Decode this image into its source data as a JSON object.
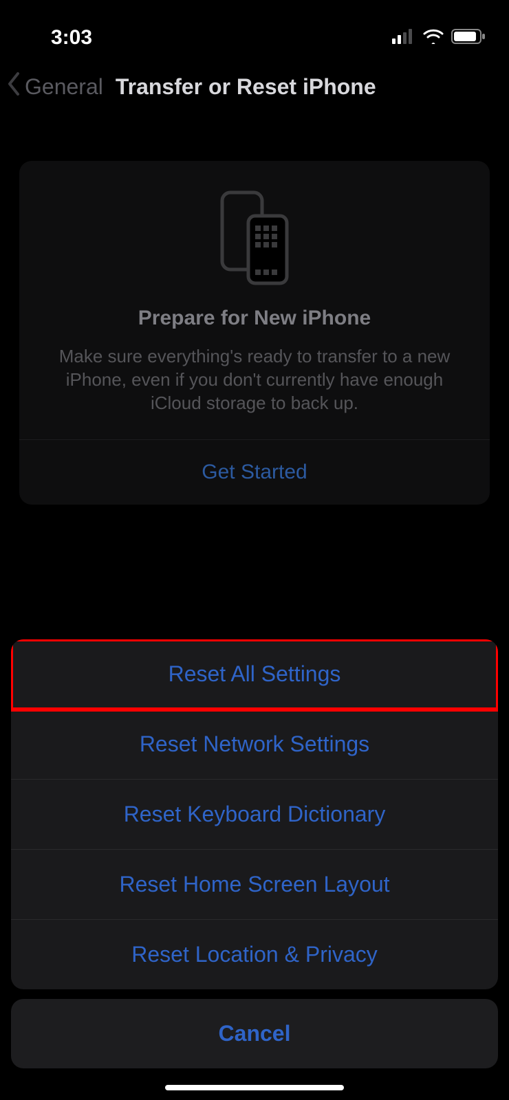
{
  "status": {
    "time": "3:03"
  },
  "nav": {
    "back_label": "General",
    "title": "Transfer or Reset iPhone"
  },
  "card": {
    "heading": "Prepare for New iPhone",
    "description": "Make sure everything's ready to transfer to a new iPhone, even if you don't currently have enough iCloud storage to back up.",
    "action": "Get Started"
  },
  "sheet": {
    "items": [
      "Reset All Settings",
      "Reset Network Settings",
      "Reset Keyboard Dictionary",
      "Reset Home Screen Layout",
      "Reset Location & Privacy"
    ],
    "cancel": "Cancel"
  }
}
